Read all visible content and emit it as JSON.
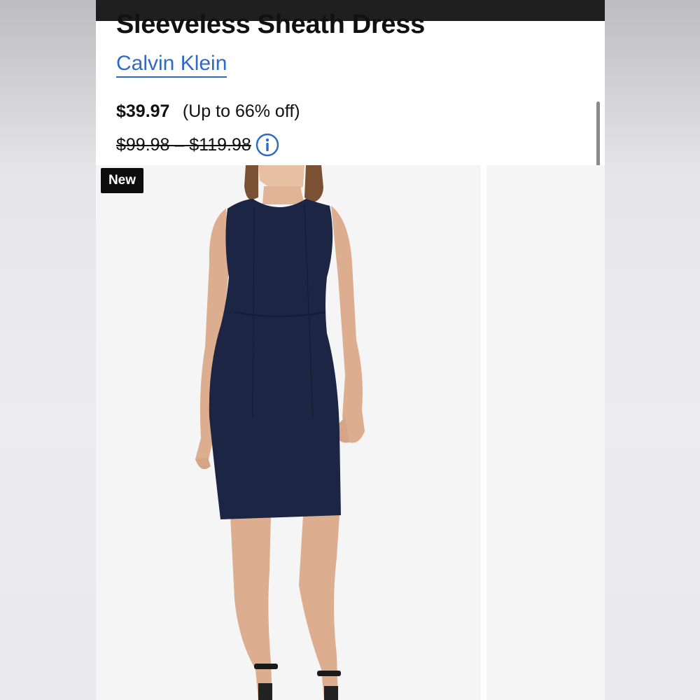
{
  "product": {
    "title": "Sleeveless Sheath Dress",
    "brand": "Calvin Klein",
    "price": "$39.97",
    "discount": "(Up to 66% off)",
    "original_price": "$99.98 – $119.98"
  },
  "gallery": {
    "badge": "New",
    "image_subject": "model-wearing-navy-sleeveless-sheath-dress"
  },
  "colors": {
    "brand_link": "#2f6bc4",
    "dress": "#1c2544",
    "status_bar": "#1f1f1f"
  },
  "icons": {
    "info": "info-icon"
  }
}
